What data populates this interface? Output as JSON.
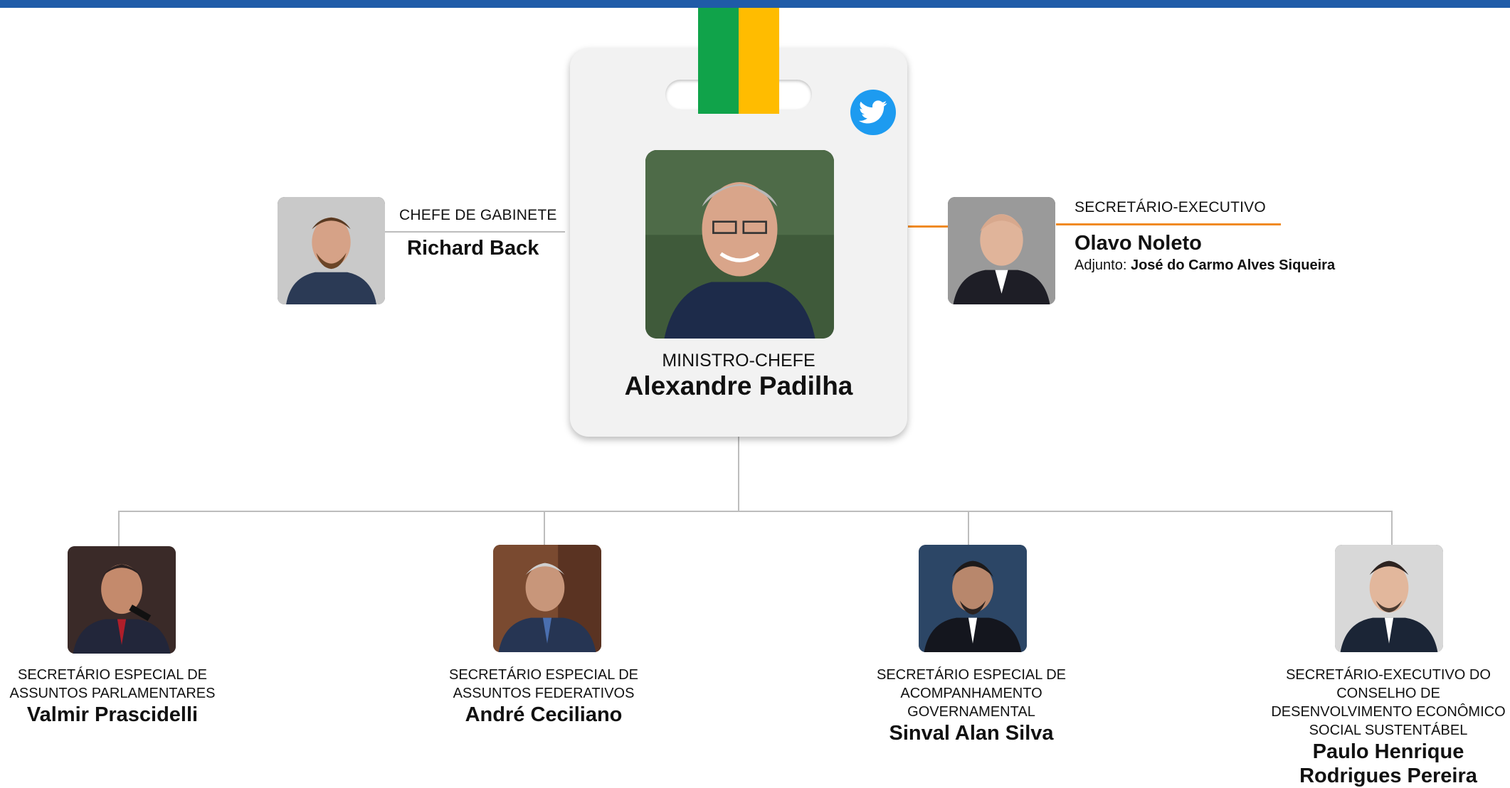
{
  "colors": {
    "top_bar": "#1f5ba8",
    "strap_green": "#10a34a",
    "strap_yellow": "#ffbc00",
    "connector": "#bdbdbd",
    "accent_orange": "#f08a24",
    "twitter_blue": "#1d9bf0"
  },
  "minister": {
    "role": "MINISTRO-CHEFE",
    "name": "Alexandre Padilha",
    "social_icon": "twitter-icon"
  },
  "chief_of_staff": {
    "role": "CHEFE DE GABINETE",
    "name": "Richard Back"
  },
  "executive_secretary": {
    "role": "SECRETÁRIO-EXECUTIVO",
    "name": "Olavo Noleto",
    "deputy_label": "Adjunto: ",
    "deputy_name": "José do Carmo Alves Siqueira"
  },
  "secretaries": [
    {
      "role_lines": [
        "SECRETÁRIO ESPECIAL DE",
        "ASSUNTOS PARLAMENTARES"
      ],
      "name_lines": [
        "Valmir Prascidelli"
      ]
    },
    {
      "role_lines": [
        "SECRETÁRIO ESPECIAL DE",
        "ASSUNTOS FEDERATIVOS"
      ],
      "name_lines": [
        "André Ceciliano"
      ]
    },
    {
      "role_lines": [
        "SECRETÁRIO ESPECIAL DE",
        "ACOMPANHAMENTO",
        "GOVERNAMENTAL"
      ],
      "name_lines": [
        "Sinval Alan Silva"
      ]
    },
    {
      "role_lines": [
        "SECRETÁRIO-EXECUTIVO DO",
        "CONSELHO DE",
        "DESENVOLVIMENTO ECONÔMICO",
        "SOCIAL SUSTENTÁBEL"
      ],
      "name_lines": [
        "Paulo Henrique",
        "Rodrigues Pereira"
      ]
    }
  ]
}
